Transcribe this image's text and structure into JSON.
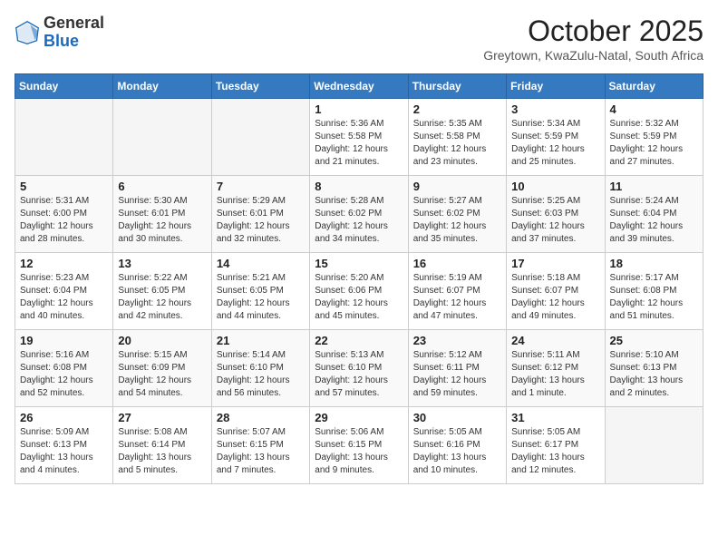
{
  "header": {
    "logo_general": "General",
    "logo_blue": "Blue",
    "month": "October 2025",
    "location": "Greytown, KwaZulu-Natal, South Africa"
  },
  "days_of_week": [
    "Sunday",
    "Monday",
    "Tuesday",
    "Wednesday",
    "Thursday",
    "Friday",
    "Saturday"
  ],
  "weeks": [
    [
      {
        "day": "",
        "sunrise": "",
        "sunset": "",
        "daylight": "",
        "empty": true
      },
      {
        "day": "",
        "sunrise": "",
        "sunset": "",
        "daylight": "",
        "empty": true
      },
      {
        "day": "",
        "sunrise": "",
        "sunset": "",
        "daylight": "",
        "empty": true
      },
      {
        "day": "1",
        "sunrise": "Sunrise: 5:36 AM",
        "sunset": "Sunset: 5:58 PM",
        "daylight": "Daylight: 12 hours and 21 minutes.",
        "empty": false
      },
      {
        "day": "2",
        "sunrise": "Sunrise: 5:35 AM",
        "sunset": "Sunset: 5:58 PM",
        "daylight": "Daylight: 12 hours and 23 minutes.",
        "empty": false
      },
      {
        "day": "3",
        "sunrise": "Sunrise: 5:34 AM",
        "sunset": "Sunset: 5:59 PM",
        "daylight": "Daylight: 12 hours and 25 minutes.",
        "empty": false
      },
      {
        "day": "4",
        "sunrise": "Sunrise: 5:32 AM",
        "sunset": "Sunset: 5:59 PM",
        "daylight": "Daylight: 12 hours and 27 minutes.",
        "empty": false
      }
    ],
    [
      {
        "day": "5",
        "sunrise": "Sunrise: 5:31 AM",
        "sunset": "Sunset: 6:00 PM",
        "daylight": "Daylight: 12 hours and 28 minutes.",
        "empty": false
      },
      {
        "day": "6",
        "sunrise": "Sunrise: 5:30 AM",
        "sunset": "Sunset: 6:01 PM",
        "daylight": "Daylight: 12 hours and 30 minutes.",
        "empty": false
      },
      {
        "day": "7",
        "sunrise": "Sunrise: 5:29 AM",
        "sunset": "Sunset: 6:01 PM",
        "daylight": "Daylight: 12 hours and 32 minutes.",
        "empty": false
      },
      {
        "day": "8",
        "sunrise": "Sunrise: 5:28 AM",
        "sunset": "Sunset: 6:02 PM",
        "daylight": "Daylight: 12 hours and 34 minutes.",
        "empty": false
      },
      {
        "day": "9",
        "sunrise": "Sunrise: 5:27 AM",
        "sunset": "Sunset: 6:02 PM",
        "daylight": "Daylight: 12 hours and 35 minutes.",
        "empty": false
      },
      {
        "day": "10",
        "sunrise": "Sunrise: 5:25 AM",
        "sunset": "Sunset: 6:03 PM",
        "daylight": "Daylight: 12 hours and 37 minutes.",
        "empty": false
      },
      {
        "day": "11",
        "sunrise": "Sunrise: 5:24 AM",
        "sunset": "Sunset: 6:04 PM",
        "daylight": "Daylight: 12 hours and 39 minutes.",
        "empty": false
      }
    ],
    [
      {
        "day": "12",
        "sunrise": "Sunrise: 5:23 AM",
        "sunset": "Sunset: 6:04 PM",
        "daylight": "Daylight: 12 hours and 40 minutes.",
        "empty": false
      },
      {
        "day": "13",
        "sunrise": "Sunrise: 5:22 AM",
        "sunset": "Sunset: 6:05 PM",
        "daylight": "Daylight: 12 hours and 42 minutes.",
        "empty": false
      },
      {
        "day": "14",
        "sunrise": "Sunrise: 5:21 AM",
        "sunset": "Sunset: 6:05 PM",
        "daylight": "Daylight: 12 hours and 44 minutes.",
        "empty": false
      },
      {
        "day": "15",
        "sunrise": "Sunrise: 5:20 AM",
        "sunset": "Sunset: 6:06 PM",
        "daylight": "Daylight: 12 hours and 45 minutes.",
        "empty": false
      },
      {
        "day": "16",
        "sunrise": "Sunrise: 5:19 AM",
        "sunset": "Sunset: 6:07 PM",
        "daylight": "Daylight: 12 hours and 47 minutes.",
        "empty": false
      },
      {
        "day": "17",
        "sunrise": "Sunrise: 5:18 AM",
        "sunset": "Sunset: 6:07 PM",
        "daylight": "Daylight: 12 hours and 49 minutes.",
        "empty": false
      },
      {
        "day": "18",
        "sunrise": "Sunrise: 5:17 AM",
        "sunset": "Sunset: 6:08 PM",
        "daylight": "Daylight: 12 hours and 51 minutes.",
        "empty": false
      }
    ],
    [
      {
        "day": "19",
        "sunrise": "Sunrise: 5:16 AM",
        "sunset": "Sunset: 6:08 PM",
        "daylight": "Daylight: 12 hours and 52 minutes.",
        "empty": false
      },
      {
        "day": "20",
        "sunrise": "Sunrise: 5:15 AM",
        "sunset": "Sunset: 6:09 PM",
        "daylight": "Daylight: 12 hours and 54 minutes.",
        "empty": false
      },
      {
        "day": "21",
        "sunrise": "Sunrise: 5:14 AM",
        "sunset": "Sunset: 6:10 PM",
        "daylight": "Daylight: 12 hours and 56 minutes.",
        "empty": false
      },
      {
        "day": "22",
        "sunrise": "Sunrise: 5:13 AM",
        "sunset": "Sunset: 6:10 PM",
        "daylight": "Daylight: 12 hours and 57 minutes.",
        "empty": false
      },
      {
        "day": "23",
        "sunrise": "Sunrise: 5:12 AM",
        "sunset": "Sunset: 6:11 PM",
        "daylight": "Daylight: 12 hours and 59 minutes.",
        "empty": false
      },
      {
        "day": "24",
        "sunrise": "Sunrise: 5:11 AM",
        "sunset": "Sunset: 6:12 PM",
        "daylight": "Daylight: 13 hours and 1 minute.",
        "empty": false
      },
      {
        "day": "25",
        "sunrise": "Sunrise: 5:10 AM",
        "sunset": "Sunset: 6:13 PM",
        "daylight": "Daylight: 13 hours and 2 minutes.",
        "empty": false
      }
    ],
    [
      {
        "day": "26",
        "sunrise": "Sunrise: 5:09 AM",
        "sunset": "Sunset: 6:13 PM",
        "daylight": "Daylight: 13 hours and 4 minutes.",
        "empty": false
      },
      {
        "day": "27",
        "sunrise": "Sunrise: 5:08 AM",
        "sunset": "Sunset: 6:14 PM",
        "daylight": "Daylight: 13 hours and 5 minutes.",
        "empty": false
      },
      {
        "day": "28",
        "sunrise": "Sunrise: 5:07 AM",
        "sunset": "Sunset: 6:15 PM",
        "daylight": "Daylight: 13 hours and 7 minutes.",
        "empty": false
      },
      {
        "day": "29",
        "sunrise": "Sunrise: 5:06 AM",
        "sunset": "Sunset: 6:15 PM",
        "daylight": "Daylight: 13 hours and 9 minutes.",
        "empty": false
      },
      {
        "day": "30",
        "sunrise": "Sunrise: 5:05 AM",
        "sunset": "Sunset: 6:16 PM",
        "daylight": "Daylight: 13 hours and 10 minutes.",
        "empty": false
      },
      {
        "day": "31",
        "sunrise": "Sunrise: 5:05 AM",
        "sunset": "Sunset: 6:17 PM",
        "daylight": "Daylight: 13 hours and 12 minutes.",
        "empty": false
      },
      {
        "day": "",
        "sunrise": "",
        "sunset": "",
        "daylight": "",
        "empty": true
      }
    ]
  ]
}
